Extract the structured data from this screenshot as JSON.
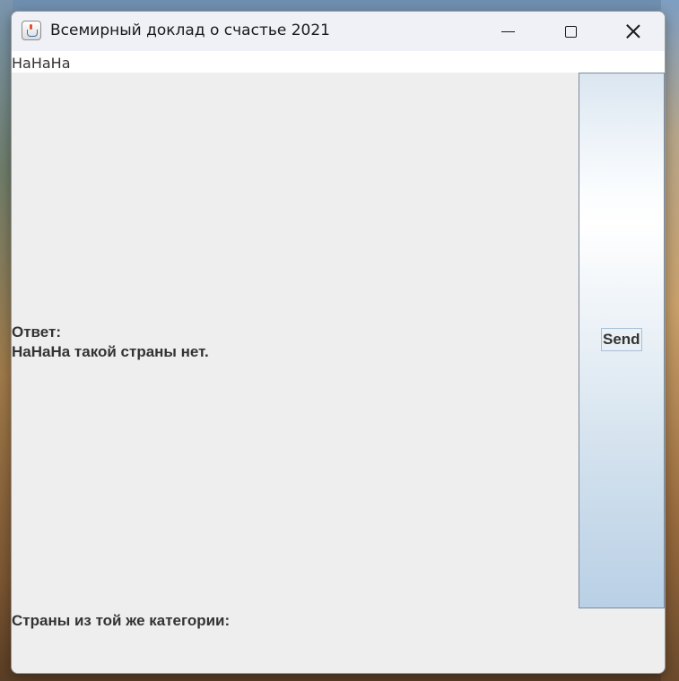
{
  "window": {
    "title": "Всемирный доклад о счастье 2021",
    "app_icon": "java-cup-icon",
    "controls": {
      "minimize_icon": "minimize-icon",
      "maximize_icon": "maximize-icon",
      "close_icon": "close-icon"
    }
  },
  "input": {
    "value": "НаНаНа"
  },
  "answer": {
    "label": "Ответ:",
    "text": "НаНаНа такой страны нет."
  },
  "send_button": {
    "label": "Send"
  },
  "same_category": {
    "label": "Страны из той же категории:"
  },
  "colors": {
    "panel_background": "#eeeeee",
    "text": "#333333",
    "button_gradient_top": "#ffffff",
    "button_gradient_bottom": "#b9d0e6"
  }
}
